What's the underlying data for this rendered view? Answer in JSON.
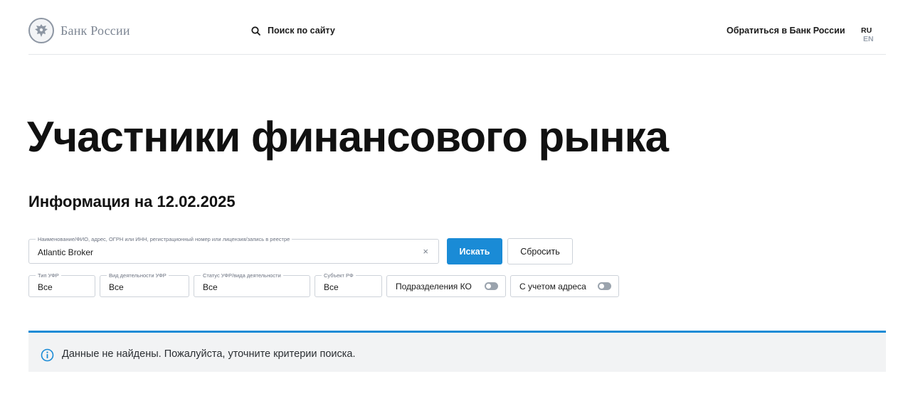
{
  "header": {
    "logo_text": "Банк России",
    "search_label": "Поиск по сайту",
    "contact_label": "Обратиться в Банк России",
    "lang_ru": "RU",
    "lang_en": "EN"
  },
  "page": {
    "title": "Участники финансового рынка",
    "info_date": "Информация на 12.02.2025"
  },
  "search": {
    "main_label": "Наименование/ФИО, адрес, ОГРН или ИНН, регистрационный номер или лицензия/запись в реестре",
    "main_value": "Atlantic Broker",
    "clear_symbol": "×",
    "search_button": "Искать",
    "reset_button": "Сбросить"
  },
  "filters": [
    {
      "label": "Тип УФР",
      "value": "Все"
    },
    {
      "label": "Вид деятельности УФР",
      "value": "Все"
    },
    {
      "label": "Статус УФР/вида деятельности",
      "value": "Все"
    },
    {
      "label": "Субъект РФ",
      "value": "Все"
    }
  ],
  "toggles": [
    {
      "label": "Подразделения КО",
      "on": false
    },
    {
      "label": "С учетом адреса",
      "on": false
    }
  ],
  "alert": {
    "icon": "info-icon",
    "text": "Данные не найдены. Пожалуйста, уточните критерии поиска."
  },
  "colors": {
    "accent": "#1a8bd6",
    "alert_bg": "#f2f3f4",
    "border": "#cdd2d9"
  }
}
